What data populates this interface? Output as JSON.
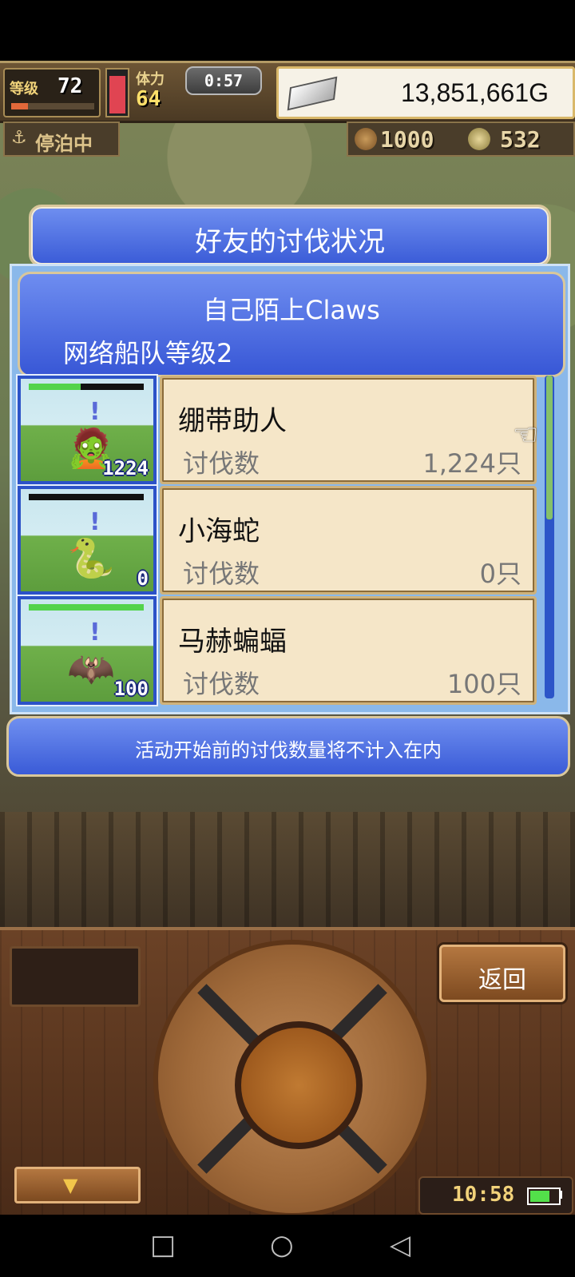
{
  "hud": {
    "level_label": "等级",
    "level_value": "72",
    "level_progress": 0.2,
    "hp_fraction": 0.95,
    "stamina_label": "体力",
    "stamina_value": "64",
    "timer": "0:57",
    "gold": "13,851,661G",
    "moor_label": "停泊中",
    "resource_bread": "1000",
    "resource_coin": "532"
  },
  "modal": {
    "title": "好友的讨伐状况",
    "friend_name": "自己陌上Claws",
    "fleet_level": "网络船队等级2",
    "note": "活动开始前的讨伐数量将不计入在内",
    "rows": [
      {
        "name": "绷带助人",
        "label": "讨伐数",
        "value": "1,224只",
        "thumb_count": "1224",
        "hp": 0.45,
        "monster_icon": "mummy-icon"
      },
      {
        "name": "小海蛇",
        "label": "讨伐数",
        "value": "0只",
        "thumb_count": "0",
        "hp": 0.0,
        "monster_icon": "sea-snake-icon"
      },
      {
        "name": "马赫蝙蝠",
        "label": "讨伐数",
        "value": "100只",
        "thumb_count": "100",
        "hp": 1.0,
        "monster_icon": "bat-icon"
      }
    ]
  },
  "controls": {
    "back_label": "返回",
    "clock": "10:58",
    "battery_fraction": 0.8
  },
  "colors": {
    "panel_blue": "#3a5bd7",
    "card_cream": "#f5e6c8",
    "hp_green": "#53d34b"
  }
}
